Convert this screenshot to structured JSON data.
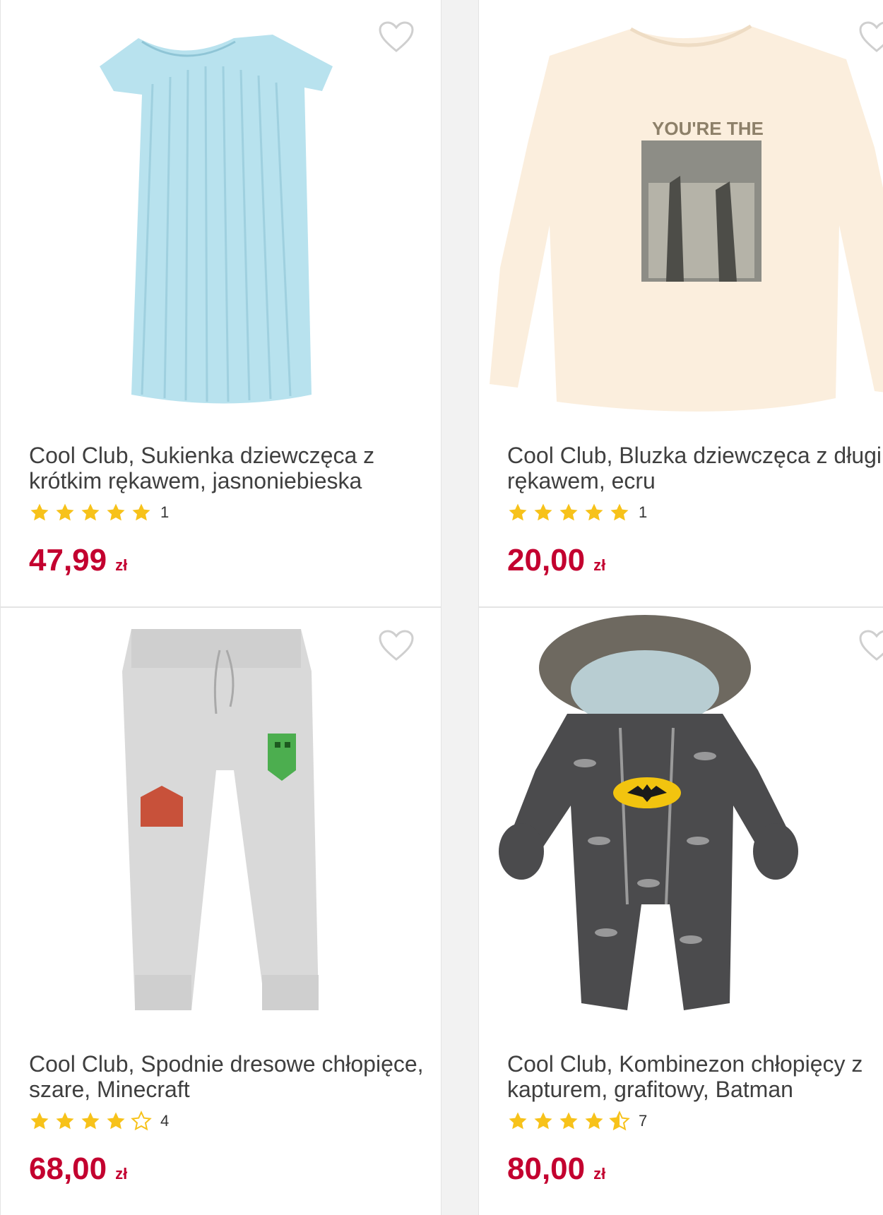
{
  "colors": {
    "price": "#c3002f",
    "star": "#f7c21a",
    "text": "#3f3f3f"
  },
  "products": [
    {
      "title": "Cool Club, Sukienka dziewczęca z krótkim rękawem, jasnoniebieska",
      "rating": 5,
      "rating_count": "1",
      "price": "47,99",
      "currency": "zł",
      "favorite_icon": "heart-outline-icon"
    },
    {
      "title": "Cool Club, Bluzka dziewczęca z długim rękawem, ecru",
      "rating": 5,
      "rating_count": "1",
      "price": "20,00",
      "currency": "zł",
      "favorite_icon": "heart-outline-icon"
    },
    {
      "title": "Cool Club, Spodnie dresowe chłopięce, szare, Minecraft",
      "rating": 4,
      "rating_count": "4",
      "price": "68,00",
      "currency": "zł",
      "favorite_icon": "heart-outline-icon"
    },
    {
      "title": "Cool Club, Kombinezon chłopięcy z kapturem, grafitowy, Batman",
      "rating": 4.5,
      "rating_count": "7",
      "price": "80,00",
      "currency": "zł",
      "favorite_icon": "heart-outline-icon"
    }
  ]
}
